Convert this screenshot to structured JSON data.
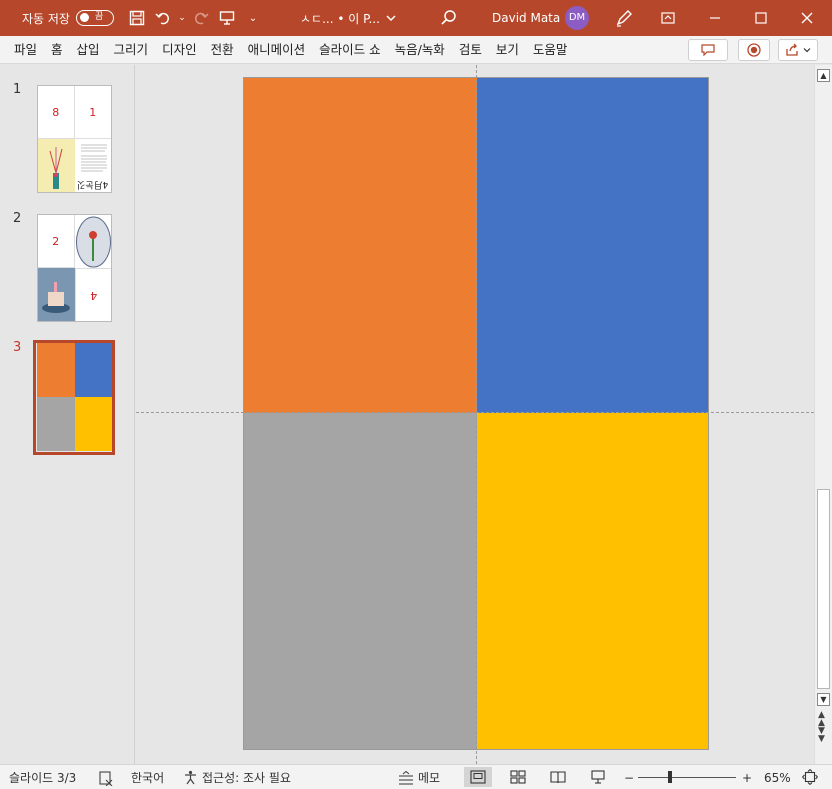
{
  "titlebar": {
    "autosave_label": "자동 저장",
    "autosave_state": "끔",
    "doc_title": "ㅅㄷ... • 이 P...",
    "user_name": "David Mata",
    "user_initials": "DM",
    "icons": [
      "save-icon",
      "undo-icon",
      "redo-icon",
      "present-icon",
      "customize-qat-icon",
      "search-icon",
      "pen-icon",
      "ribbon-display-icon",
      "minimize-icon",
      "maximize-icon",
      "close-icon"
    ]
  },
  "ribbon": {
    "tabs": [
      "파일",
      "홈",
      "삽입",
      "그리기",
      "디자인",
      "전환",
      "애니메이션",
      "슬라이드 쇼",
      "녹음/녹화",
      "검토",
      "보기",
      "도움말"
    ]
  },
  "thumbnails": [
    {
      "number": "1",
      "top_left": "8",
      "top_right": "1",
      "bottom_text": "4月눈깃"
    },
    {
      "number": "2",
      "top_left": "2",
      "bottom_right": "4"
    },
    {
      "number": "3"
    }
  ],
  "slide": {
    "colors": {
      "orange": "#ed7d31",
      "blue": "#4472c4",
      "gray": "#a5a5a5",
      "gold": "#ffc000"
    }
  },
  "statusbar": {
    "slide_info": "슬라이드 3/3",
    "language": "한국어",
    "accessibility": "접근성: 조사 필요",
    "notes_label": "메모",
    "zoom_minus": "−",
    "zoom_plus": "+",
    "zoom_level": "65%"
  },
  "colors": {
    "accent": "#b7472a"
  }
}
